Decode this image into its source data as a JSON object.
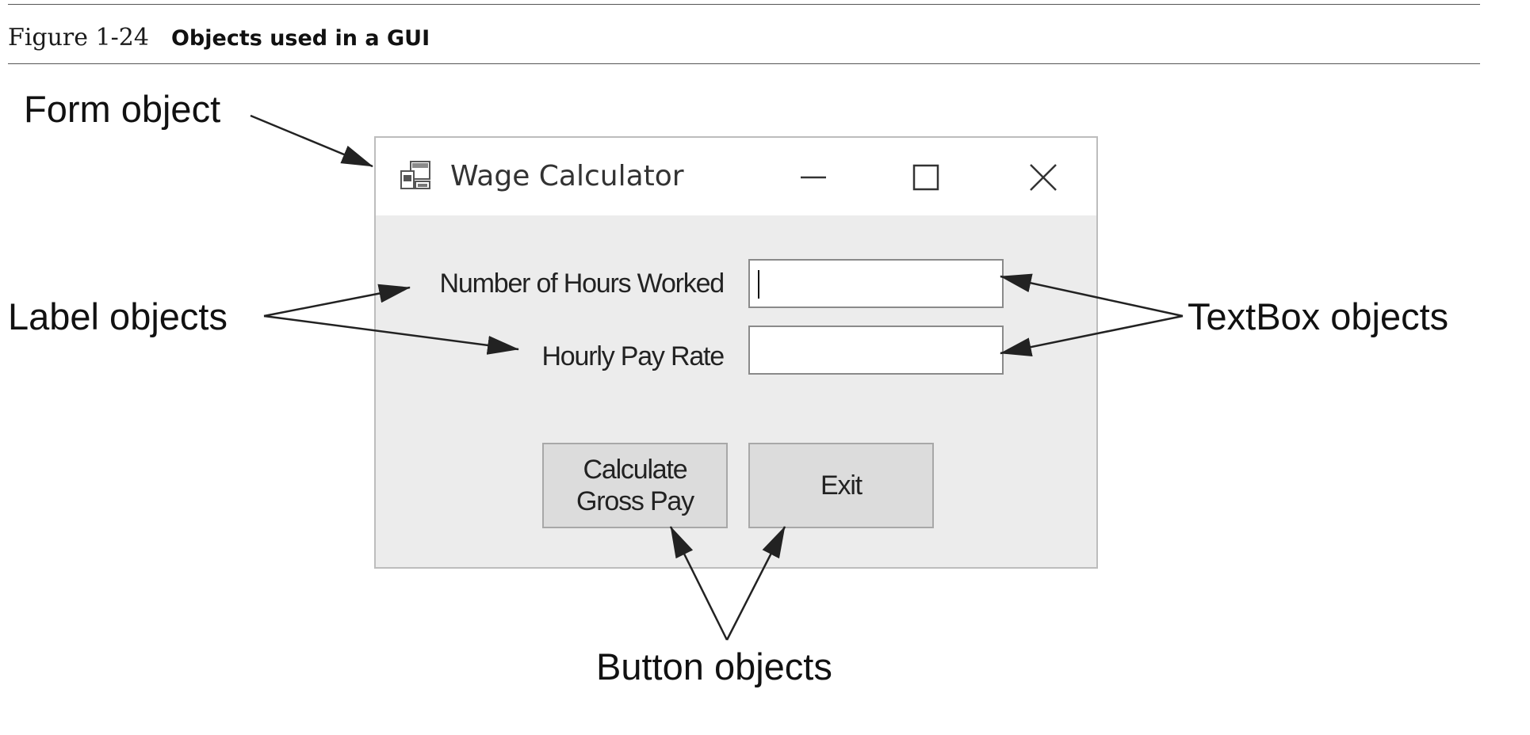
{
  "figure": {
    "number": "Figure 1-24",
    "title": "Objects used in a GUI"
  },
  "callouts": {
    "form": "Form object",
    "label": "Label objects",
    "textbox": "TextBox objects",
    "button": "Button objects"
  },
  "window": {
    "title": "Wage Calculator",
    "icon": "app-form-icon",
    "controls": [
      "minimize-icon",
      "maximize-icon",
      "close-icon"
    ]
  },
  "form": {
    "hours_label": "Number of Hours Worked",
    "hours_value": "",
    "rate_label": "Hourly Pay Rate",
    "rate_value": "",
    "calculate_button_line1": "Calculate",
    "calculate_button_line2": "Gross Pay",
    "exit_button": "Exit"
  },
  "colors": {
    "form_background": "#ececec",
    "titlebar": "#ffffff",
    "button": "#dcdcdc",
    "arrow": "#222222"
  }
}
